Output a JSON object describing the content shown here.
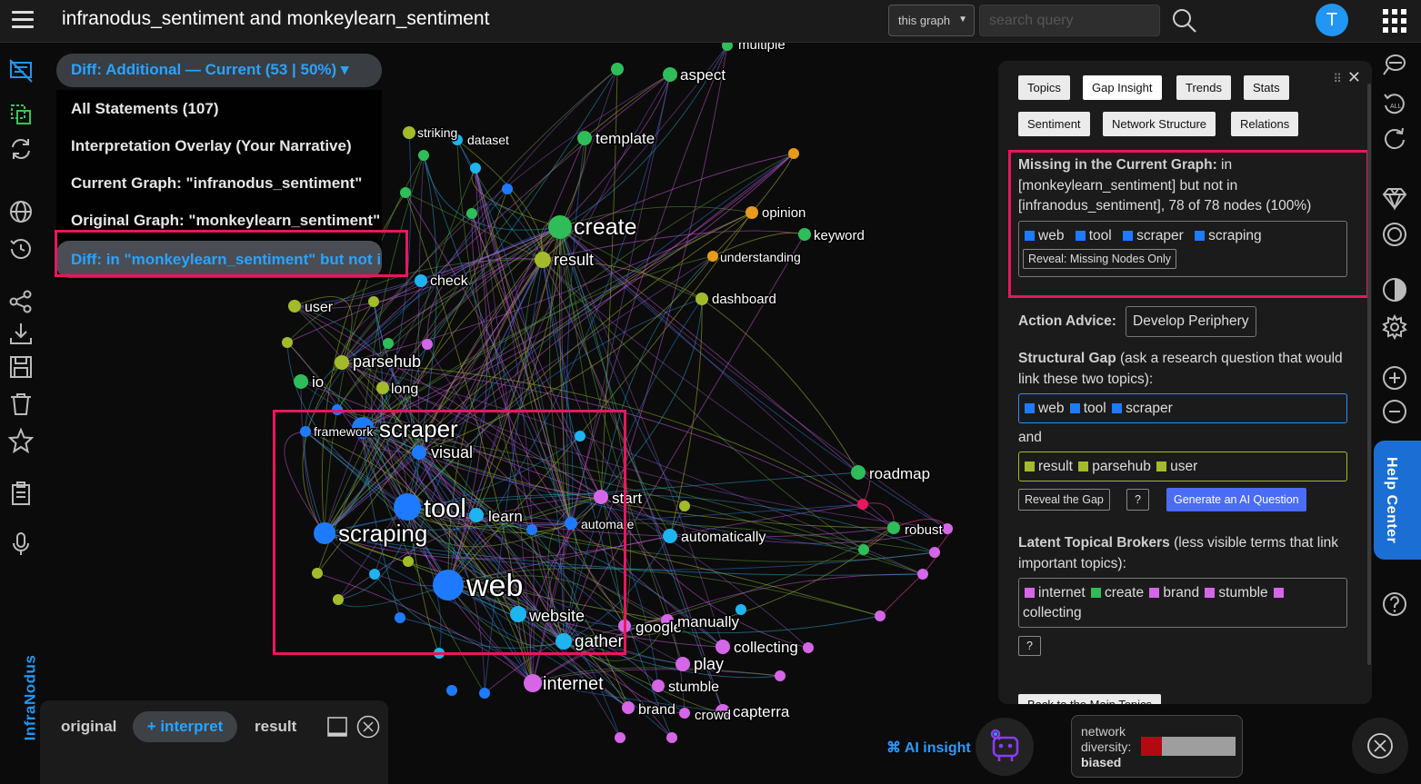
{
  "header": {
    "title": "infranodus_sentiment and monkeylearn_sentiment",
    "graph_select": "this graph",
    "search_placeholder": "search query",
    "avatar_letter": "T"
  },
  "brand": "InfraNodus",
  "diff_dropdown": {
    "label": "Diff: Additional — Current (53 | 50%) ▾",
    "items": [
      "All Statements (107)",
      "Interpretation Overlay (Your Narrative)",
      "Current Graph: \"infranodus_sentiment\"",
      "Original Graph: \"monkeylearn_sentiment\"",
      "Diff: in \"monkeylearn_sentiment\" but not in"
    ]
  },
  "graph": {
    "labels": [
      "multiple",
      "aspect",
      "striking",
      "dataset",
      "template",
      "create",
      "result",
      "opinion",
      "keyword",
      "understanding",
      "check",
      "dashboard",
      "user",
      "parsehub",
      "io",
      "long",
      "framework",
      "scraper",
      "visual",
      "tool",
      "learn",
      "start",
      "automate",
      "automatically",
      "scraping",
      "web",
      "website",
      "gather",
      "google",
      "manually",
      "collecting",
      "play",
      "stumble",
      "internet",
      "brand",
      "crowd",
      "capterra",
      "roadmap",
      "robust"
    ]
  },
  "panel": {
    "tabs_row1": [
      "Topics",
      "Gap Insight",
      "Trends",
      "Stats"
    ],
    "tabs_row2": [
      "Sentiment",
      "Network Structure",
      "Relations"
    ],
    "missing_title": "Missing in the Current Graph:",
    "missing_text": " in [monkeylearn_sentiment] but not in [infranodus_sentiment], 78 of 78 nodes (100%)",
    "missing_terms": [
      "web",
      "tool",
      "scraper",
      "scraping"
    ],
    "reveal_missing_btn": "Reveal: Missing Nodes Only",
    "action_label": "Action Advice:",
    "action_value": "Develop Periphery",
    "structural_gap_title": "Structural Gap",
    "structural_gap_text": " (ask a research question that would link these two topics):",
    "gap_topic1": [
      "web",
      "tool",
      "scraper"
    ],
    "and_label": "and",
    "gap_topic2": [
      "result",
      "parsehub",
      "user"
    ],
    "reveal_gap_btn": "Reveal the Gap",
    "question_btn": "?",
    "generate_btn": "Generate an AI Question",
    "brokers_title": "Latent Topical Brokers",
    "brokers_text": " (less visible terms that link important topics):",
    "brokers": [
      "internet",
      "create",
      "brand",
      "stumble",
      "collecting"
    ],
    "brokers_help": "?",
    "back_btn": "Back to the Main Topics"
  },
  "help_center": "Help Center",
  "bottom": {
    "tab_original": "original",
    "tab_interpret": "+ interpret",
    "tab_result": "result"
  },
  "ai_insight": "⌘ AI insight",
  "diversity": {
    "label1": "network",
    "label2": "diversity:",
    "value": "biased",
    "level": 0.22
  },
  "colors": {
    "accent": "#2196f3",
    "highlight": "#e8175d",
    "blue_node": "#1e7bff",
    "cyan_node": "#1db4f0",
    "green_node": "#2ebd59",
    "olive_node": "#a3bb2a",
    "pink_node": "#d666e8",
    "orange_node": "#e89a1a",
    "red_node": "#e8175d"
  }
}
